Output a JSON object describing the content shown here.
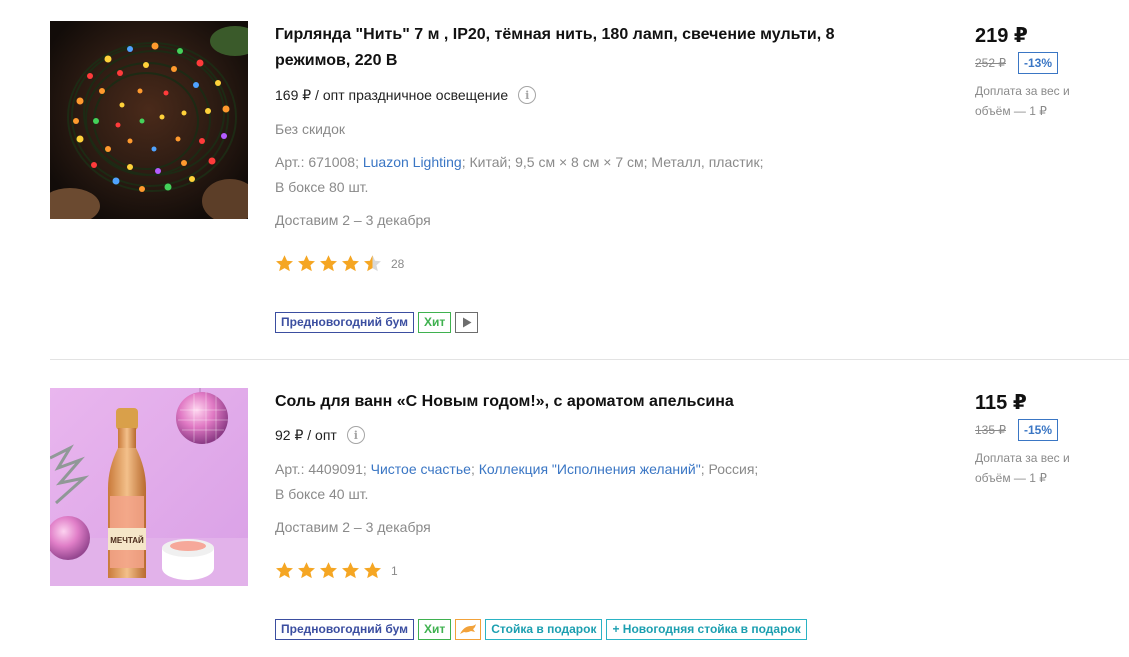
{
  "products": [
    {
      "title": "Гирлянда \"Нить\" 7 м , IP20, тёмная нить, 180 ламп, свечение мульти, 8 режимов, 220 В",
      "opt_price": "169 ₽ / опт праздничное освещение",
      "discount_note": "Без скидок",
      "sku": "Арт.: 671008;",
      "brand": "Luazon Lighting",
      "country": "Китай;",
      "size": "9,5 см × 8 см × 7 см;",
      "material": "Металл, пластик;",
      "box": "В боксе 80 шт.",
      "delivery": "Доставим 2 – 3 декабря",
      "rating": 4.5,
      "reviews": "28",
      "badges": [
        "Предновогодний бум",
        "Хит"
      ],
      "price": "219 ₽",
      "old_price": "252 ₽",
      "discount": "-13%",
      "extra_fee": "Доплата за вес и объём — 1 ₽"
    },
    {
      "title": "Соль для ванн «С Новым годом!», с ароматом апельсина",
      "opt_price": "92 ₽ / опт",
      "sku": "Арт.: 4409091;",
      "brand": "Чистое счастье",
      "collection": "Коллекция \"Исполнения желаний\"",
      "country": "Россия;",
      "box": "В боксе 40 шт.",
      "delivery": "Доставим 2 – 3 декабря",
      "rating": 5,
      "reviews": "1",
      "badges": [
        "Предновогодний бум",
        "Хит",
        "Стойка в подарок",
        "+ Новогодняя стойка в подарок"
      ],
      "price": "115 ₽",
      "old_price": "135 ₽",
      "discount": "-15%",
      "extra_fee": "Доплата за вес и объём — 1 ₽"
    }
  ],
  "colors": {
    "link": "#3a76c4",
    "star": "#f5a623",
    "badge_blue": "#3b4ea0",
    "badge_green": "#3fb14f",
    "badge_teal": "#2ab3c4"
  },
  "icons": [
    "info-icon",
    "star-icon",
    "half-star-icon",
    "play-icon",
    "dolphin-icon"
  ]
}
